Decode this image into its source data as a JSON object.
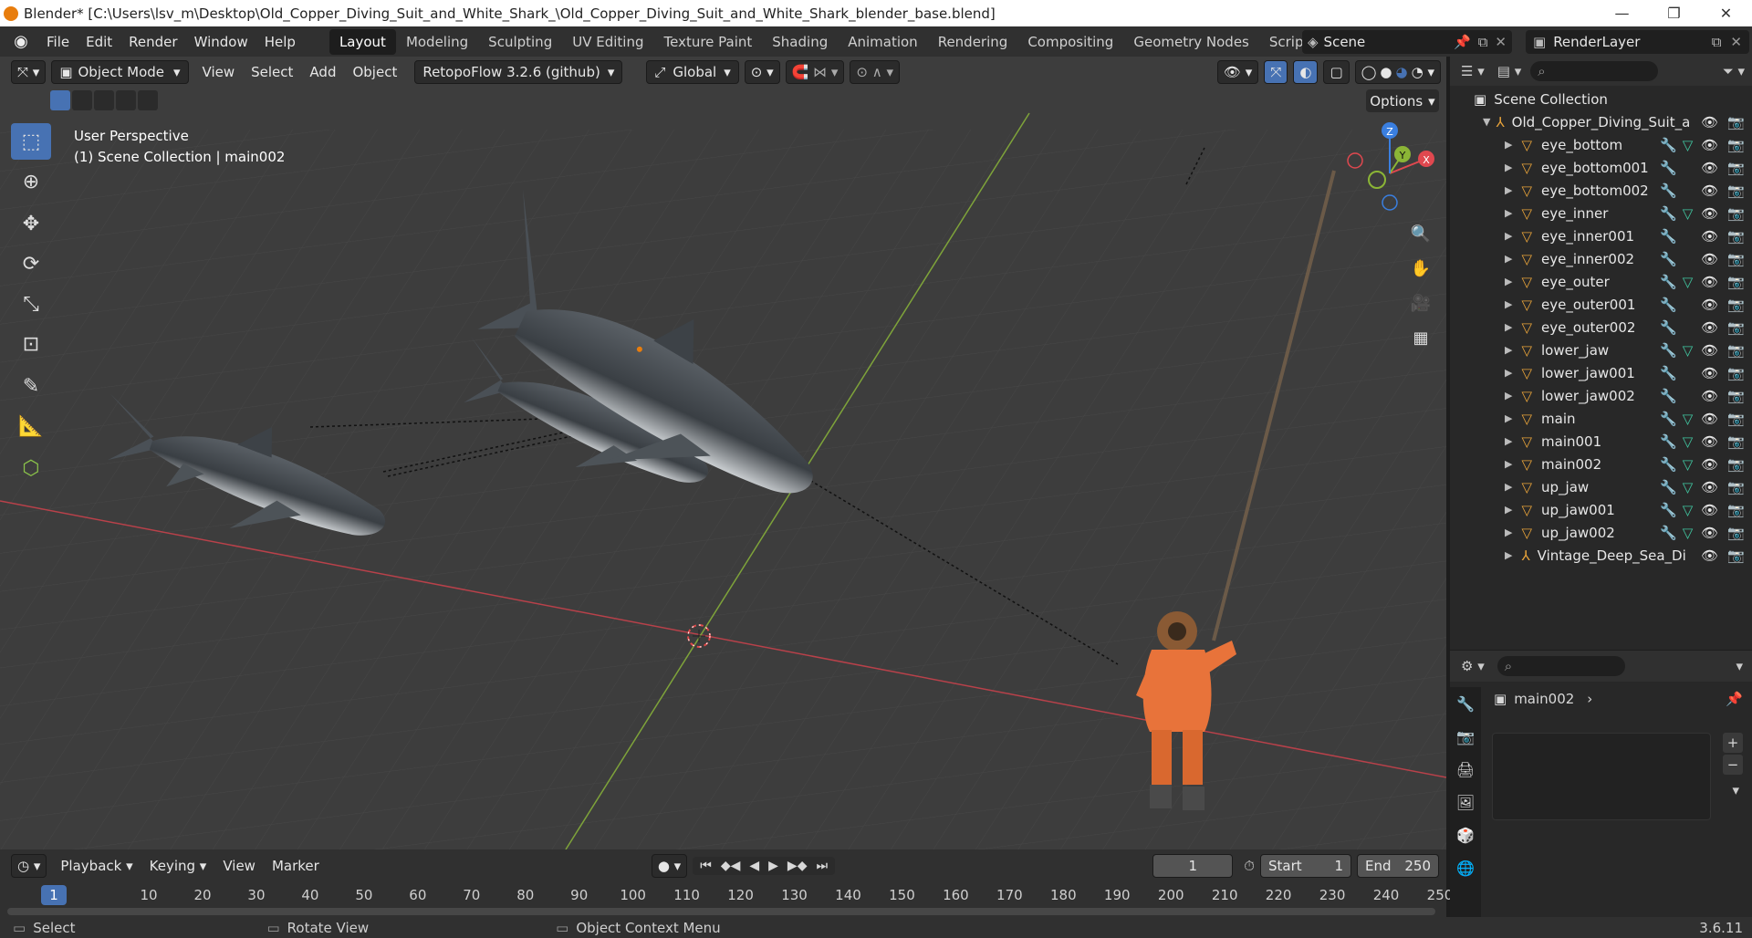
{
  "window": {
    "title": "Blender* [C:\\Users\\lsv_m\\Desktop\\Old_Copper_Diving_Suit_and_White_Shark_\\Old_Copper_Diving_Suit_and_White_Shark_blender_base.blend]",
    "minimize": "—",
    "maximize": "❐",
    "close": "✕"
  },
  "menubar": {
    "items": [
      "File",
      "Edit",
      "Render",
      "Window",
      "Help"
    ],
    "workspaces": [
      "Layout",
      "Modeling",
      "Sculpting",
      "UV Editing",
      "Texture Paint",
      "Shading",
      "Animation",
      "Rendering",
      "Compositing",
      "Geometry Nodes",
      "Scripting"
    ],
    "active_workspace": "Layout",
    "add_workspace": "+",
    "scene": "Scene",
    "render_layer": "RenderLayer"
  },
  "viewport": {
    "mode": "Object Mode",
    "menus": [
      "View",
      "Select",
      "Add",
      "Object"
    ],
    "addon": "RetopoFlow 3.2.6 (github)",
    "orientation": "Global",
    "options": "Options",
    "perspective": "User Perspective",
    "collection_info": "(1) Scene Collection | main002",
    "gizmo": {
      "x": "X",
      "y": "Y",
      "z": "Z"
    }
  },
  "timeline": {
    "menus": [
      "Playback",
      "Keying",
      "View",
      "Marker"
    ],
    "current_frame": "1",
    "start_label": "Start",
    "start": "1",
    "end_label": "End",
    "end": "250",
    "ticks": [
      "1",
      "10",
      "20",
      "30",
      "40",
      "50",
      "60",
      "70",
      "80",
      "90",
      "100",
      "110",
      "120",
      "130",
      "140",
      "150",
      "160",
      "170",
      "180",
      "190",
      "200",
      "210",
      "220",
      "230",
      "240",
      "250"
    ]
  },
  "statusbar": {
    "select": "Select",
    "rotate": "Rotate View",
    "context": "Object Context Menu",
    "version": "3.6.11"
  },
  "outliner": {
    "root": "Scene Collection",
    "parent": "Old_Copper_Diving_Suit_a",
    "items": [
      {
        "name": "eye_bottom",
        "mesh": true
      },
      {
        "name": "eye_bottom001",
        "mesh": false
      },
      {
        "name": "eye_bottom002",
        "mesh": false
      },
      {
        "name": "eye_inner",
        "mesh": true
      },
      {
        "name": "eye_inner001",
        "mesh": false
      },
      {
        "name": "eye_inner002",
        "mesh": false
      },
      {
        "name": "eye_outer",
        "mesh": true
      },
      {
        "name": "eye_outer001",
        "mesh": false
      },
      {
        "name": "eye_outer002",
        "mesh": false
      },
      {
        "name": "lower_jaw",
        "mesh": true
      },
      {
        "name": "lower_jaw001",
        "mesh": false
      },
      {
        "name": "lower_jaw002",
        "mesh": false
      },
      {
        "name": "main",
        "mesh": true
      },
      {
        "name": "main001",
        "mesh": true
      },
      {
        "name": "main002",
        "mesh": true
      },
      {
        "name": "up_jaw",
        "mesh": true
      },
      {
        "name": "up_jaw001",
        "mesh": true
      },
      {
        "name": "up_jaw002",
        "mesh": true
      }
    ],
    "last": "Vintage_Deep_Sea_Di"
  },
  "properties": {
    "object": "main002"
  },
  "colors": {
    "accent": "#4772b3",
    "x_axis": "#e0484f",
    "y_axis": "#8bb536",
    "z_axis": "#3a7fe0",
    "diver": "#e8733a"
  }
}
